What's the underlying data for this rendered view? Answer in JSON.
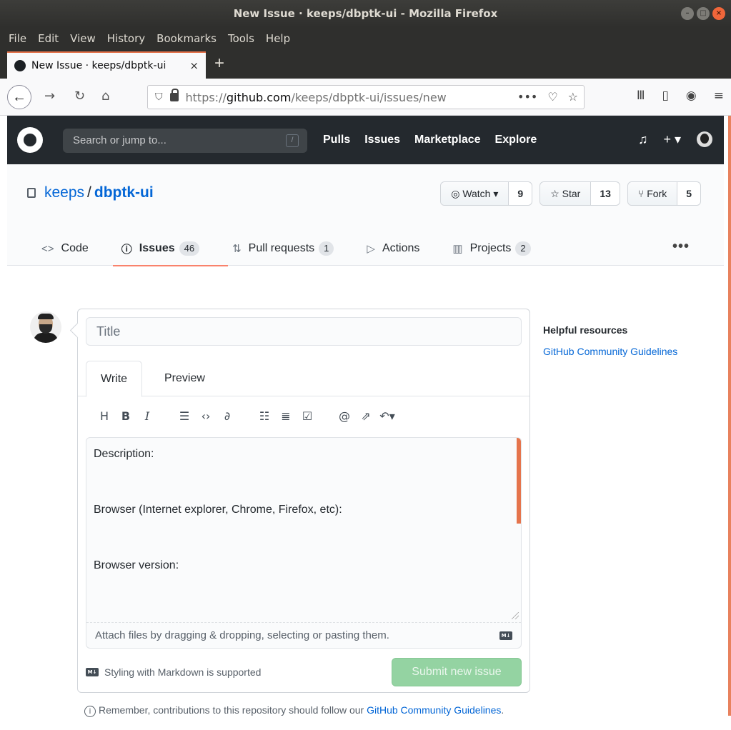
{
  "window": {
    "title": "New Issue · keeps/dbptk-ui - Mozilla Firefox",
    "controls": [
      "–",
      "□",
      "×"
    ]
  },
  "menubar": {
    "items": [
      "File",
      "Edit",
      "View",
      "History",
      "Bookmarks",
      "Tools",
      "Help"
    ]
  },
  "tabs": [
    {
      "title": "New Issue · keeps/dbptk-ui",
      "close": "×"
    }
  ],
  "newtab_label": "+",
  "navbar": {
    "url_prefix": "https://",
    "url_host": "github.com",
    "url_path": "/keeps/dbptk-ui/issues/new",
    "page_actions_label": "•••"
  },
  "github_header": {
    "search_placeholder": "Search or jump to...",
    "search_shortcut": "/",
    "nav": [
      "Pulls",
      "Issues",
      "Marketplace",
      "Explore"
    ],
    "new_menu_label": "+ ▾"
  },
  "repo": {
    "owner": "keeps",
    "separator": "/",
    "name": "dbptk-ui",
    "watch": {
      "label": "Watch ▾",
      "count": "9"
    },
    "star": {
      "label": "Star",
      "count": "13"
    },
    "fork": {
      "label": "Fork",
      "count": "5"
    }
  },
  "reponav": [
    {
      "label": "Code",
      "icon": "<>",
      "counter": ""
    },
    {
      "label": "Issues",
      "icon": "ⓘ",
      "counter": "46"
    },
    {
      "label": "Pull requests",
      "icon": "⇅",
      "counter": "1"
    },
    {
      "label": "Actions",
      "icon": "▷",
      "counter": ""
    },
    {
      "label": "Projects",
      "icon": "▥",
      "counter": "2"
    }
  ],
  "more_label": "•••",
  "issue_form": {
    "title_placeholder": "Title",
    "tab_write": "Write",
    "tab_preview": "Preview",
    "body_lines": [
      "Description:",
      "",
      "",
      "Browser (Internet explorer, Chrome, Firefox, etc):",
      "",
      "",
      "Browser version:"
    ],
    "attach_text": "Attach files by dragging & dropping, selecting or pasting them.",
    "markdown_note": "Styling with Markdown is supported",
    "submit_label": "Submit new issue",
    "md_badge": "M↓"
  },
  "contrib_note": {
    "prefix": "Remember, contributions to this repository should follow our ",
    "link": "GitHub Community Guidelines",
    "suffix": "."
  },
  "sidebar": {
    "heading": "Helpful resources",
    "link": "GitHub Community Guidelines"
  },
  "colors": {
    "firefox_accent": "#e5744c",
    "github_header": "#24292e",
    "link": "#0366d6",
    "submit_disabled": "#94d3a2",
    "selected_tab_underline": "#f9826c"
  }
}
